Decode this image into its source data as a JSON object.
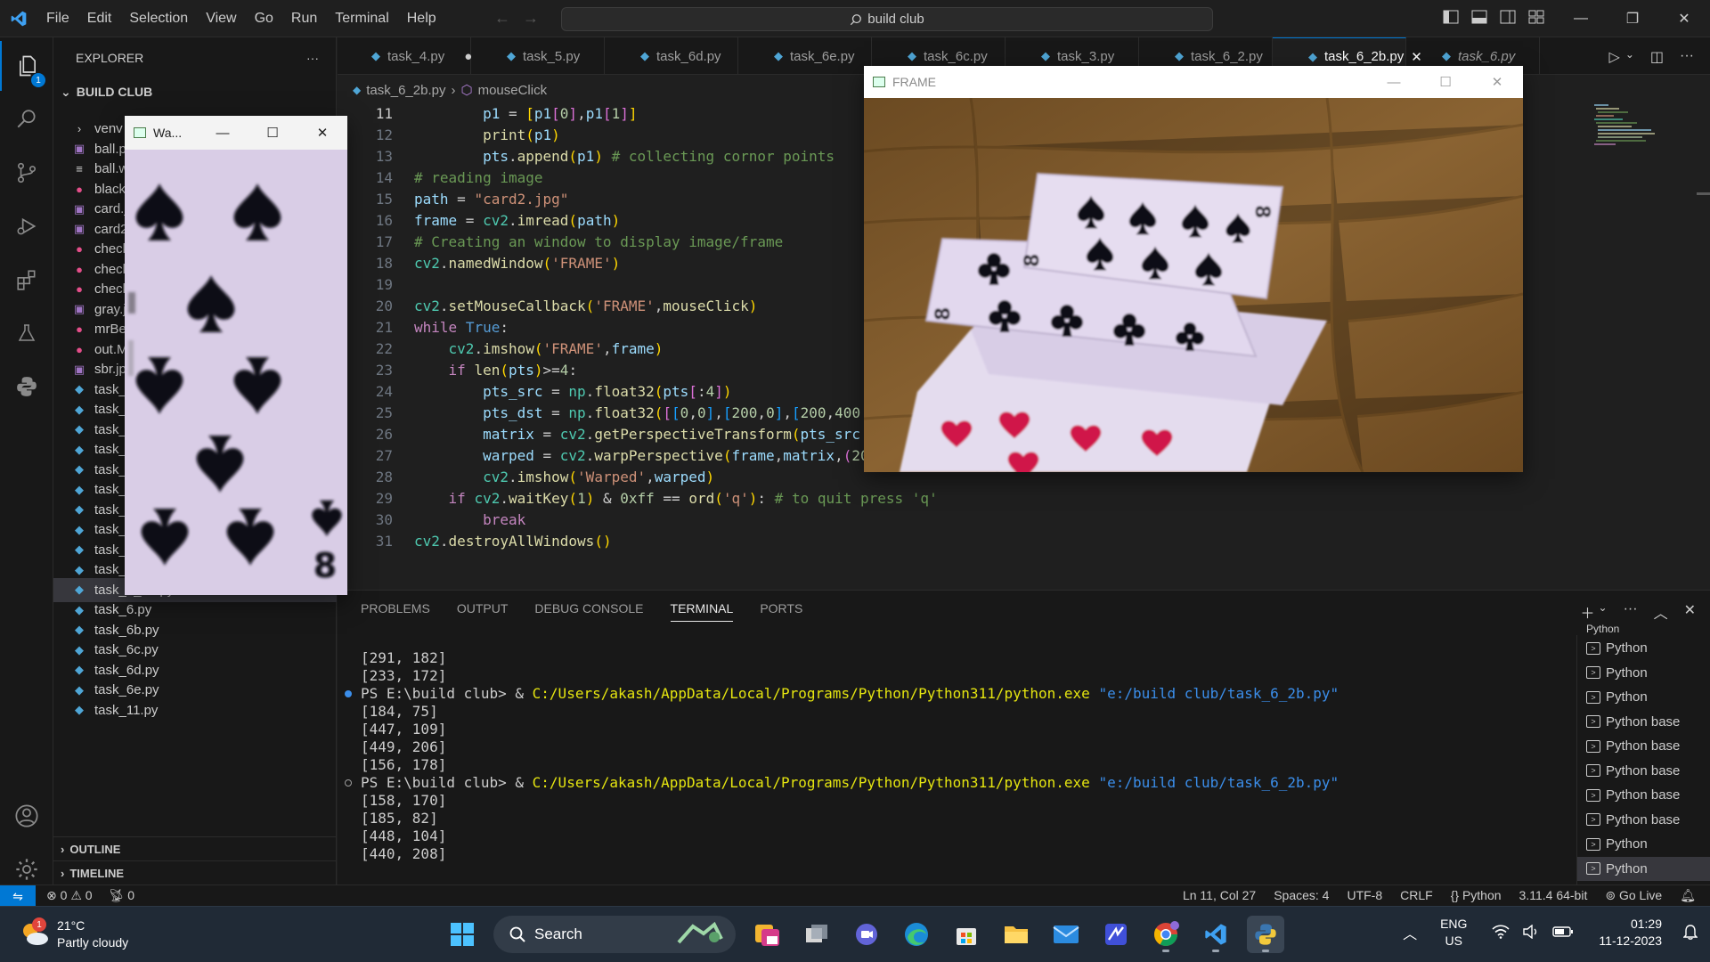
{
  "title_bar": {
    "menus": [
      "File",
      "Edit",
      "Selection",
      "View",
      "Go",
      "Run",
      "Terminal",
      "Help"
    ],
    "search": "build club"
  },
  "activity_bar": {
    "explorer_badge": "1"
  },
  "sidebar": {
    "header": "EXPLORER",
    "folder": "BUILD CLUB",
    "files": [
      {
        "name": "venv",
        "icon": "chevron-right"
      },
      {
        "name": "ball.p",
        "icon": "image"
      },
      {
        "name": "ball.w",
        "icon": "lines"
      },
      {
        "name": "black",
        "icon": "record"
      },
      {
        "name": "card.j",
        "icon": "image"
      },
      {
        "name": "card2",
        "icon": "image"
      },
      {
        "name": "check",
        "icon": "record"
      },
      {
        "name": "check",
        "icon": "record"
      },
      {
        "name": "check",
        "icon": "record"
      },
      {
        "name": "gray.j",
        "icon": "image"
      },
      {
        "name": "mrBe",
        "icon": "record"
      },
      {
        "name": "out.M",
        "icon": "record"
      },
      {
        "name": "sbr.jp",
        "icon": "image"
      },
      {
        "name": "task_",
        "icon": "python"
      },
      {
        "name": "task_",
        "icon": "python"
      },
      {
        "name": "task_",
        "icon": "python"
      },
      {
        "name": "task_",
        "icon": "python"
      },
      {
        "name": "task_",
        "icon": "python"
      },
      {
        "name": "task_",
        "icon": "python"
      },
      {
        "name": "task_",
        "icon": "python"
      },
      {
        "name": "task_5.py",
        "icon": "python"
      },
      {
        "name": "task_5b.py",
        "icon": "python"
      },
      {
        "name": "task_6_2.py",
        "icon": "python"
      },
      {
        "name": "task_6_2b.py",
        "icon": "python"
      },
      {
        "name": "task_6.py",
        "icon": "python"
      },
      {
        "name": "task_6b.py",
        "icon": "python"
      },
      {
        "name": "task_6c.py",
        "icon": "python"
      },
      {
        "name": "task_6d.py",
        "icon": "python"
      },
      {
        "name": "task_6e.py",
        "icon": "python"
      },
      {
        "name": "task_11.py",
        "icon": "python"
      }
    ],
    "outline": "OUTLINE",
    "timeline": "TIMELINE"
  },
  "tabs": [
    {
      "label": "task_4.py",
      "modified": "●"
    },
    {
      "label": "task_5.py"
    },
    {
      "label": "task_6d.py"
    },
    {
      "label": "task_6e.py"
    },
    {
      "label": "task_6c.py"
    },
    {
      "label": "task_3.py"
    },
    {
      "label": "task_6_2.py"
    },
    {
      "label": "task_6_2b.py",
      "close": "✕"
    },
    {
      "label": "task_6.py"
    }
  ],
  "breadcrumb": {
    "file": "task_6_2b.py",
    "symbol": "mouseClick"
  },
  "editor": {
    "line_numbers": [
      "11",
      "12",
      "13",
      "14",
      "15",
      "16",
      "17",
      "18",
      "19",
      "20",
      "21",
      "22",
      "23",
      "24",
      "25",
      "26",
      "27",
      "28",
      "29",
      "30",
      "31"
    ]
  },
  "panel": {
    "tabs": [
      "PROBLEMS",
      "OUTPUT",
      "DEBUG CONSOLE",
      "TERMINAL",
      "PORTS"
    ],
    "terminal": {
      "prompt": "PS E:\\build club> & ",
      "exe": "C:/Users/akash/AppData/Local/Programs/Python/Python311/python.exe",
      "script": "\"e:/build club/task_6_2b.py\"",
      "pre_lines": [
        "[291, 182]",
        "[233, 172]"
      ],
      "run1": [
        "[184, 75]",
        "[447, 109]",
        "[449, 206]",
        "[156, 178]"
      ],
      "run2": [
        "[158, 170]",
        "[185, 82]",
        "[448, 104]",
        "[440, 208]"
      ]
    },
    "terminal_list": [
      "Python",
      "Python",
      "Python",
      "Python base",
      "Python base",
      "Python base",
      "Python base",
      "Python base",
      "Python",
      "Python"
    ],
    "terminal_list_partial": "Python"
  },
  "status_bar": {
    "errors": "0",
    "warnings": "0",
    "ports": "0",
    "position": "Ln 11, Col 27",
    "spaces": "Spaces: 4",
    "encoding": "UTF-8",
    "eol": "CRLF",
    "language": "Python",
    "interpreter": "3.11.4 64-bit",
    "live": "Go Live"
  },
  "warped_window": {
    "title": "Wa...",
    "card_rank": "8"
  },
  "frame_window": {
    "title": "FRAME"
  },
  "taskbar": {
    "temp": "21°C",
    "weather": "Partly cloudy",
    "weather_badge": "1",
    "search": "Search",
    "lang1": "ENG",
    "lang2": "US",
    "time": "01:29",
    "date": "11-12-2023"
  },
  "colors": {
    "accent": "#0078d4",
    "background": "#1f1f1f",
    "sidebar": "#181818"
  }
}
